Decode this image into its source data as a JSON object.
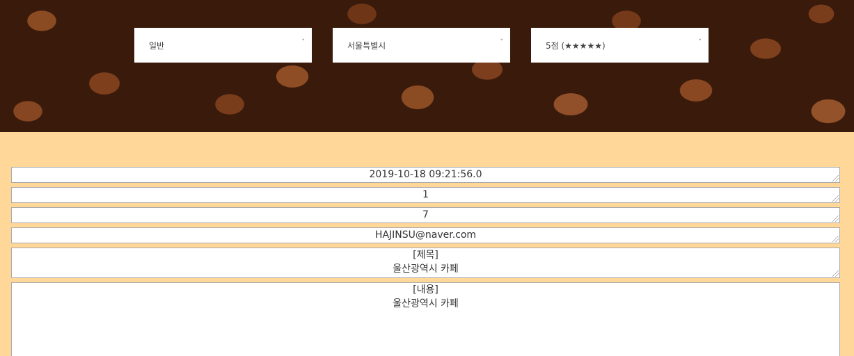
{
  "filters": {
    "category": "일반",
    "region": "서울특별시",
    "rating": "5점 (★★★★★)",
    "chevron": "˅"
  },
  "post": {
    "date": "2019-10-18 09:21:56.0",
    "number_1": "1",
    "number_2": "7",
    "email": "HAJINSU@naver.com",
    "title_label": "[제목]",
    "title_value": "울산광역시 카페",
    "content_label": "[내용]",
    "content_value": "울산광역시 카페"
  },
  "colors": {
    "page_background": "#ffd799",
    "hero_image": "coffee-beans"
  }
}
